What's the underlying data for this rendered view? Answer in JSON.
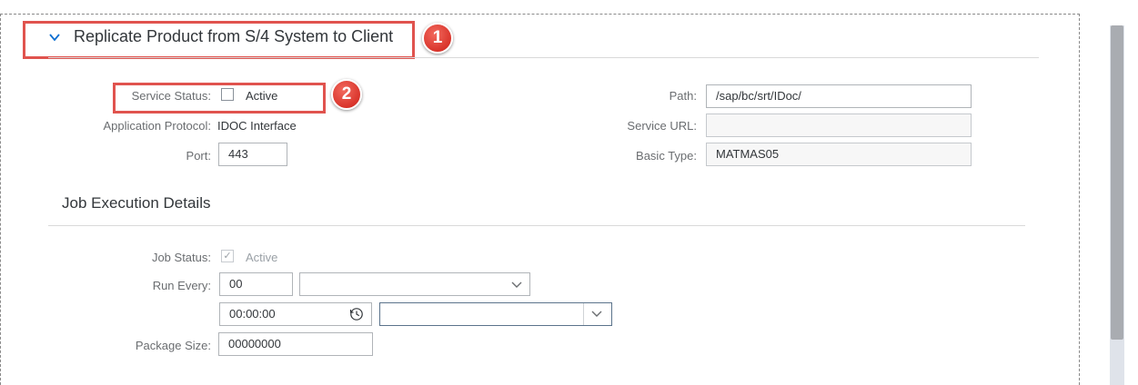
{
  "section": {
    "title": "Replicate Product from S/4 System to Client"
  },
  "annotations": {
    "badge1": "1",
    "badge2": "2"
  },
  "config": {
    "service_status_label": "Service Status:",
    "service_status_value": "Active",
    "service_status_checked": false,
    "application_protocol_label": "Application Protocol:",
    "application_protocol_value": "IDOC Interface",
    "port_label": "Port:",
    "port_value": "443",
    "path_label": "Path:",
    "path_value": "/sap/bc/srt/IDoc/",
    "service_url_label": "Service URL:",
    "service_url_value": "",
    "basic_type_label": "Basic Type:",
    "basic_type_value": "MATMAS05"
  },
  "job": {
    "title": "Job Execution Details",
    "job_status_label": "Job Status:",
    "job_status_value": "Active",
    "job_status_checked": true,
    "run_every_label": "Run Every:",
    "run_every_value": "00",
    "run_every_unit": "",
    "time_value": "00:00:00",
    "time_unit": "",
    "package_size_label": "Package Size:",
    "package_size_value": "00000000"
  },
  "colors": {
    "highlight": "#e0534e",
    "badge": "#d9342b"
  }
}
